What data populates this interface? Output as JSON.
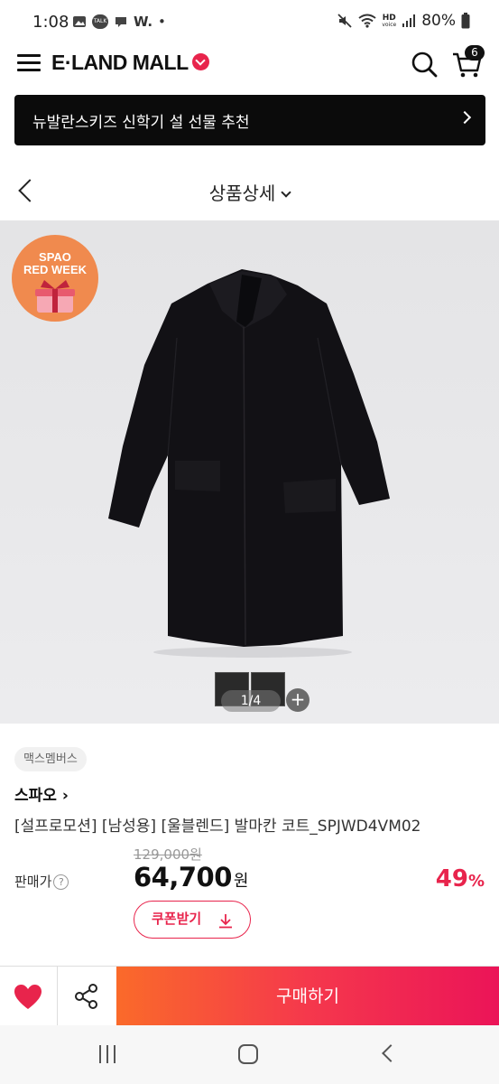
{
  "status_bar": {
    "time": "1:08",
    "notif_w": "W.",
    "notif_dot": "•",
    "hd": "HD",
    "voice": "voice",
    "battery": "80%",
    "talk": "TALK"
  },
  "header": {
    "logo": "E·LAND MALL",
    "cart_count": "6"
  },
  "banner": {
    "text": "뉴발란스키즈 신학기 설 선물 추천"
  },
  "title_bar": {
    "title": "상품상세"
  },
  "hero": {
    "badge_line1": "SPAO",
    "badge_line2": "RED WEEK",
    "pager": "1/4",
    "plus": "+"
  },
  "product": {
    "tag": "맥스멤버스",
    "brand": "스파오 ›",
    "name": "[설프로모션] [남성용] [울블렌드] 발마칸 코트_SPJWD4VM02",
    "original_price": "129,000원",
    "sale_label": "판매가",
    "help": "?",
    "price": "64,700",
    "currency": "원",
    "discount": "49",
    "discount_unit": "%",
    "coupon_label": "쿠폰받기"
  },
  "bottom_bar": {
    "buy_label": "구매하기"
  },
  "colors": {
    "accent": "#e8244c",
    "buy_start": "#fa6a2a",
    "buy_end": "#eb1458"
  }
}
